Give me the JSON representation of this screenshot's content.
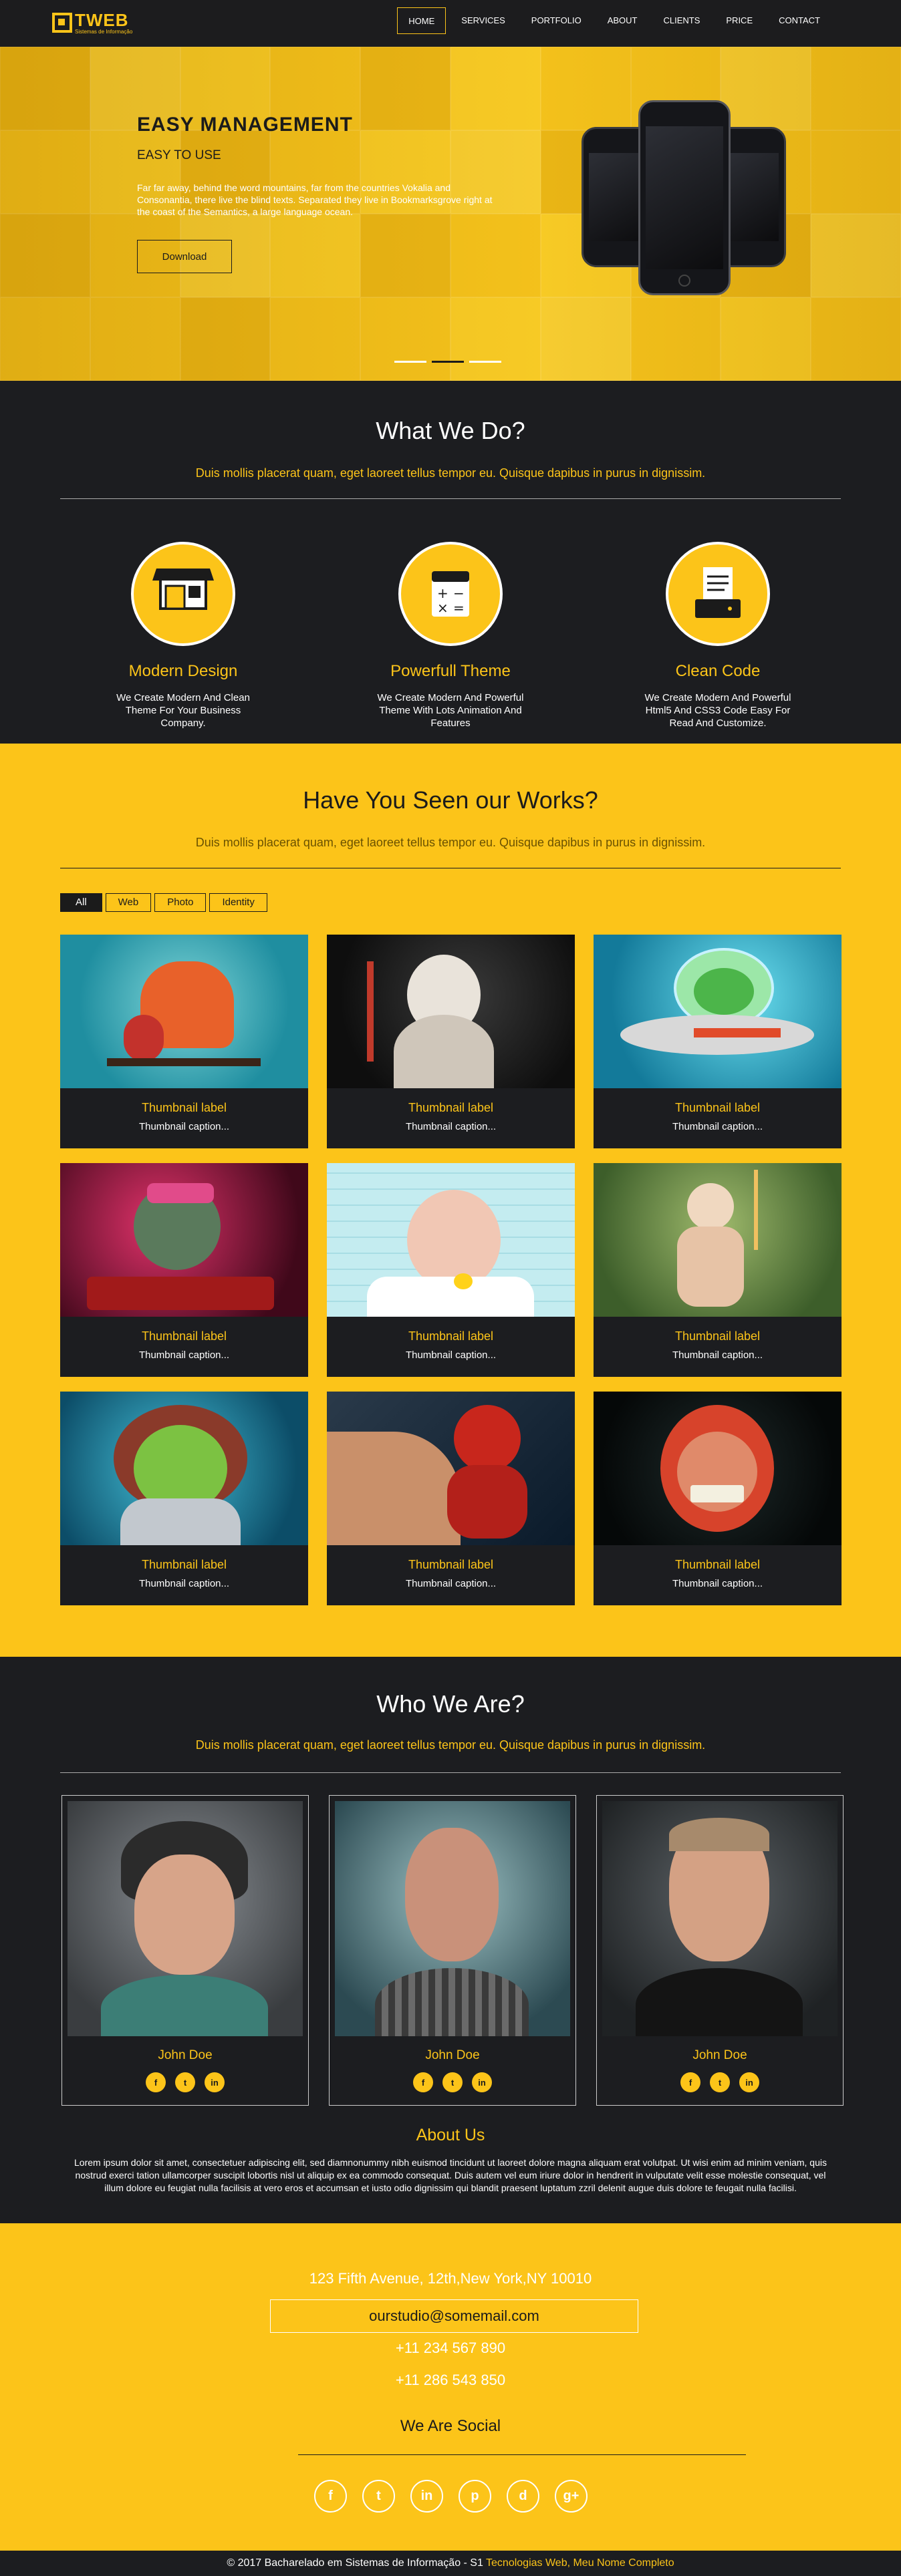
{
  "nav": {
    "logo_title": "TWEB",
    "logo_subtitle": "Sistemas de Informação",
    "items": [
      {
        "label": "HOME"
      },
      {
        "label": "SERVICES"
      },
      {
        "label": "PORTFOLIO"
      },
      {
        "label": "ABOUT"
      },
      {
        "label": "CLIENTS"
      },
      {
        "label": "PRICE"
      },
      {
        "label": "CONTACT"
      }
    ],
    "active": "HOME"
  },
  "hero": {
    "title": "EASY MANAGEMENT",
    "subtitle": "EASY TO USE",
    "text": "Far far away, behind the word mountains, far from the countries Vokalia and Consonantia, there live the blind texts. Separated they live in Bookmarksgrove right at the coast of the Semantics, a large language ocean.",
    "button": "Download",
    "slides_active_index": 1,
    "slides_count": 3
  },
  "what": {
    "title": "What We Do?",
    "lead": "Duis mollis placerat quam, eget laoreet tellus tempor eu. Quisque dapibus in purus in dignissim.",
    "services": [
      {
        "icon": "shop-icon",
        "title": "Modern Design",
        "text": "We Create Modern And Clean Theme For Your Business Company."
      },
      {
        "icon": "calculator-icon",
        "title": "Powerfull Theme",
        "text": "We Create Modern And Powerful Theme With Lots Animation And Features"
      },
      {
        "icon": "document-icon",
        "title": "Clean Code",
        "text": "We Create Modern And Powerful Html5 And CSS3 Code Easy For Read And Customize."
      }
    ]
  },
  "works": {
    "title": "Have You Seen our Works?",
    "lead": "Duis mollis placerat quam, eget laoreet tellus tempor eu. Quisque dapibus in purus in dignissim.",
    "filters": [
      "All",
      "Web",
      "Photo",
      "Identity"
    ],
    "active_filter": "All",
    "items": [
      {
        "label": "Thumbnail label",
        "caption": "Thumbnail caption..."
      },
      {
        "label": "Thumbnail label",
        "caption": "Thumbnail caption..."
      },
      {
        "label": "Thumbnail label",
        "caption": "Thumbnail caption..."
      },
      {
        "label": "Thumbnail label",
        "caption": "Thumbnail caption..."
      },
      {
        "label": "Thumbnail label",
        "caption": "Thumbnail caption..."
      },
      {
        "label": "Thumbnail label",
        "caption": "Thumbnail caption..."
      },
      {
        "label": "Thumbnail label",
        "caption": "Thumbnail caption..."
      },
      {
        "label": "Thumbnail label",
        "caption": "Thumbnail caption..."
      },
      {
        "label": "Thumbnail label",
        "caption": "Thumbnail caption..."
      }
    ]
  },
  "who": {
    "title": "Who We Are?",
    "lead": "Duis mollis placerat quam, eget laoreet tellus tempor eu. Quisque dapibus in purus in dignissim.",
    "members": [
      {
        "name": "John Doe",
        "social": [
          "f",
          "t",
          "in"
        ]
      },
      {
        "name": "John Doe",
        "social": [
          "f",
          "t",
          "in"
        ]
      },
      {
        "name": "John Doe",
        "social": [
          "f",
          "t",
          "in"
        ]
      }
    ],
    "about_title": "About Us",
    "about_text": "Lorem ipsum dolor sit amet, consectetuer adipiscing elit, sed diamnonummy nibh euismod tincidunt ut laoreet dolore magna aliquam erat volutpat. Ut wisi enim ad minim veniam, quis nostrud exerci tation ullamcorper suscipit lobortis nisl ut aliquip ex ea commodo consequat. Duis autem vel eum iriure dolor in hendrerit in vulputate velit esse molestie consequat, vel illum dolore eu feugiat nulla facilisis at vero eros et accumsan et iusto odio dignissim qui blandit praesent luptatum zzril delenit augue duis dolore te feugait nulla facilisi."
  },
  "contact": {
    "address": "123 Fifth Avenue, 12th,New York,NY 10010",
    "email": "ourstudio@somemail.com",
    "phone1": "+11 234 567 890",
    "phone2": "+11 286 543 850",
    "social_title": "We Are Social",
    "social_icons": [
      "f",
      "t",
      "in",
      "p",
      "d",
      "g+"
    ]
  },
  "footer": {
    "text": "© 2017 Bacharelado em Sistemas de Informação - S1 ",
    "highlight": "Tecnologias Web, Meu Nome Completo"
  },
  "colors": {
    "accent": "#fcc419",
    "dark": "#1c1d20"
  }
}
